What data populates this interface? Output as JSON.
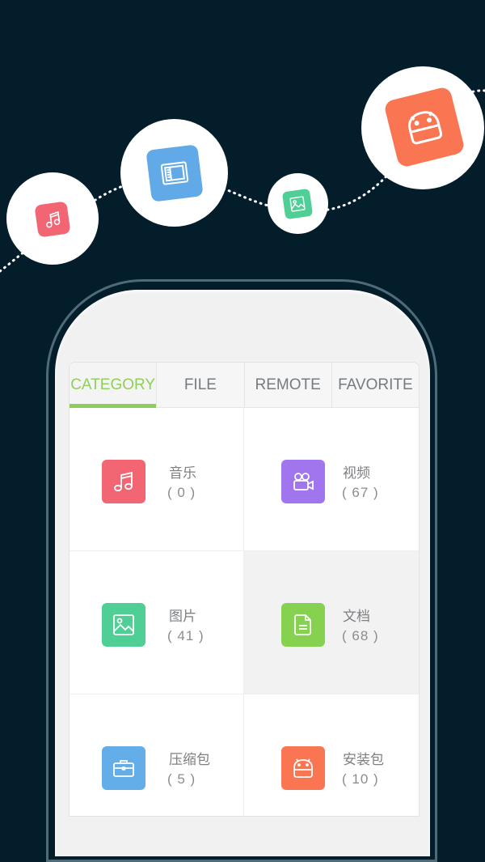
{
  "colors": {
    "background": "#031d2b",
    "accent_green": "#8cce5a",
    "music": "#f26674",
    "video": "#a175ee",
    "image": "#4fcf95",
    "document": "#86d250",
    "archive": "#63aee8",
    "apk": "#fa7551",
    "book": "#62a9e8"
  },
  "floating_icons": [
    {
      "name": "music-note-icon",
      "color": "#f26674"
    },
    {
      "name": "book-icon",
      "color": "#62a9e8"
    },
    {
      "name": "image-icon",
      "color": "#4fcf95"
    },
    {
      "name": "android-icon",
      "color": "#fa7551"
    }
  ],
  "tabs": [
    {
      "label": "CATEGORY",
      "active": true
    },
    {
      "label": "FILE",
      "active": false
    },
    {
      "label": "REMOTE",
      "active": false
    },
    {
      "label": "FAVORITE",
      "active": false
    }
  ],
  "categories": [
    {
      "label": "音乐",
      "count": "( 0 )",
      "icon": "music-note-icon"
    },
    {
      "label": "视频",
      "count": "( 67 )",
      "icon": "video-camera-icon"
    },
    {
      "label": "图片",
      "count": "( 41 )",
      "icon": "image-icon"
    },
    {
      "label": "文档",
      "count": "( 68 )",
      "icon": "document-icon"
    },
    {
      "label": "压缩包",
      "count": "( 5 )",
      "icon": "briefcase-icon"
    },
    {
      "label": "安装包",
      "count": "( 10 )",
      "icon": "android-icon"
    }
  ]
}
